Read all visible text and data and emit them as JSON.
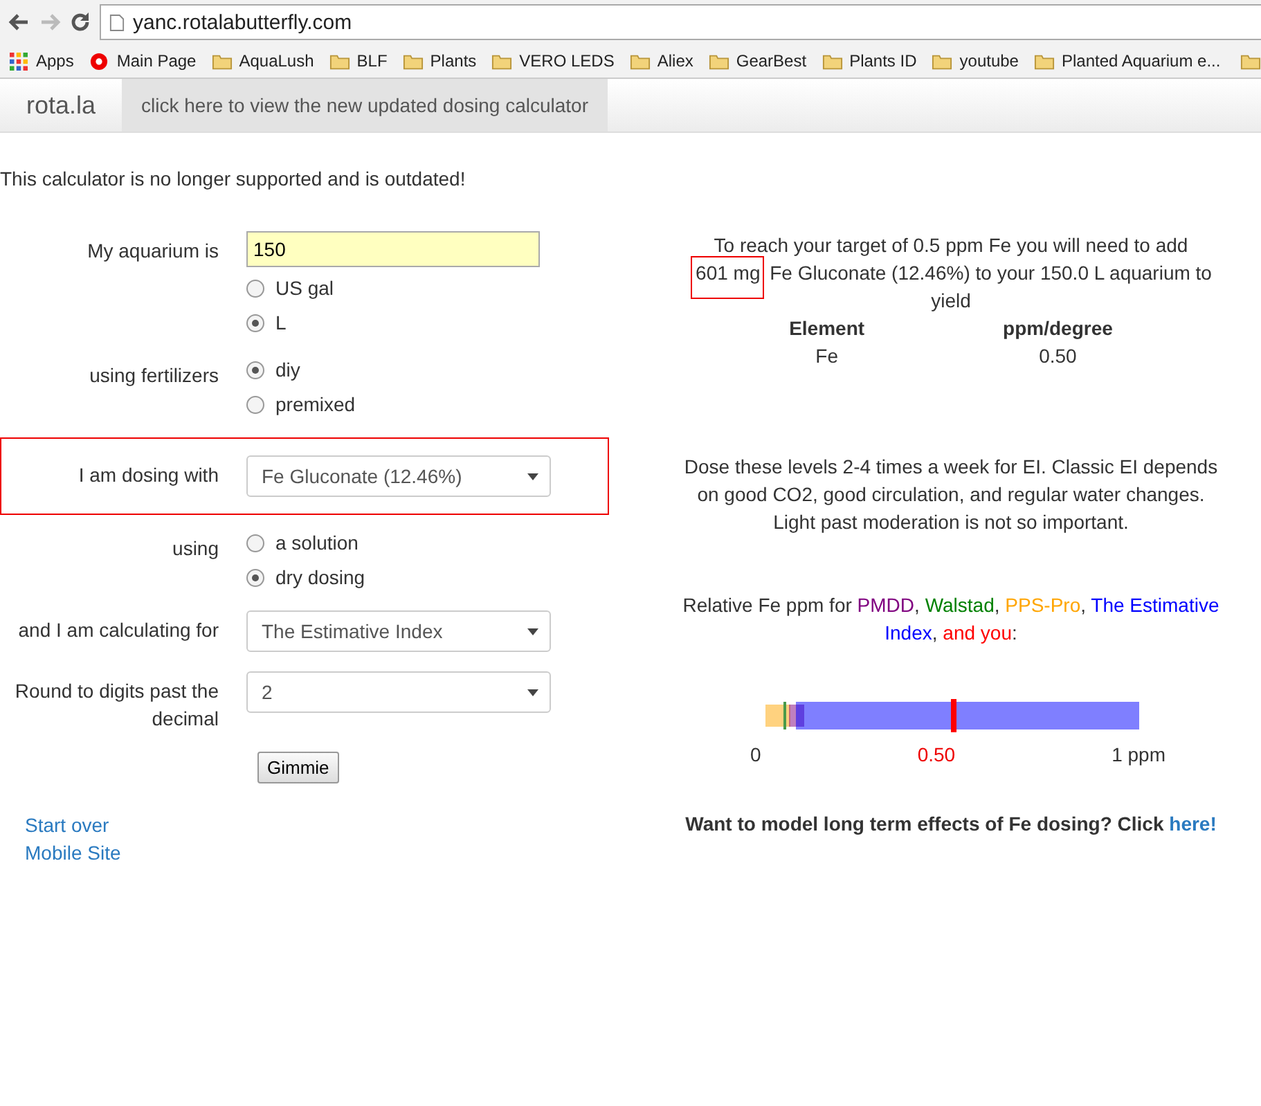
{
  "browser": {
    "url": "yanc.rotalabutterfly.com",
    "bookmarks": [
      {
        "label": "Apps",
        "kind": "apps"
      },
      {
        "label": "Main Page",
        "kind": "site"
      },
      {
        "label": "AquaLush",
        "kind": "folder"
      },
      {
        "label": "BLF",
        "kind": "folder"
      },
      {
        "label": "Plants",
        "kind": "folder"
      },
      {
        "label": "VERO LEDS",
        "kind": "folder"
      },
      {
        "label": "Aliex",
        "kind": "folder"
      },
      {
        "label": "GearBest",
        "kind": "folder"
      },
      {
        "label": "Plants ID",
        "kind": "folder"
      },
      {
        "label": "youtube",
        "kind": "folder"
      },
      {
        "label": "Planted Aquarium e...",
        "kind": "folder"
      }
    ],
    "bookmarks_cut_off": true
  },
  "navbar": {
    "brand": "rota.la",
    "link": "click here to view the new updated dosing calculator"
  },
  "notice": "This calculator is no longer supported and is outdated!",
  "form": [
    {
      "kind": "input",
      "label": "My aquarium is",
      "value": "150",
      "options": [
        {
          "label": "US gal",
          "selected": false
        },
        {
          "label": "L",
          "selected": true
        }
      ]
    },
    {
      "kind": "radio",
      "label": "using fertilizers",
      "options": [
        {
          "label": "diy",
          "selected": true
        },
        {
          "label": "premixed",
          "selected": false
        }
      ]
    },
    {
      "kind": "select",
      "label": "I am dosing with",
      "value": "Fe Gluconate (12.46%)",
      "highlighted": true
    },
    {
      "kind": "radio",
      "label": "using",
      "options": [
        {
          "label": "a solution",
          "selected": false
        },
        {
          "label": "dry dosing",
          "selected": true
        }
      ]
    },
    {
      "kind": "select",
      "label": "and I am calculating for",
      "value": "The Estimative Index",
      "highlighted": false
    },
    {
      "kind": "select",
      "label": "Round to digits past the decimal",
      "value": "2",
      "highlighted": false
    }
  ],
  "submit": "Gimmie",
  "links": [
    "Start over",
    "Mobile Site"
  ],
  "result": {
    "before": "To reach your target of 0.5 ppm Fe you will need to add",
    "amount": "601 mg",
    "amount_highlighted": true,
    "after": "Fe Gluconate (12.46%) to your 150.0 L aquarium to yield",
    "columns": [
      "Element",
      "ppm/degree"
    ],
    "rows": [
      [
        "Fe",
        "0.50"
      ]
    ]
  },
  "advice": "Dose these levels 2-4 times a week for EI. Classic EI depends on good CO2, good circulation, and regular water changes. Light past moderation is not so important.",
  "legend": [
    {
      "text": "Relative Fe ppm for ",
      "color": "#333333"
    },
    {
      "text": "PMDD",
      "color": "#800080"
    },
    {
      "text": ", ",
      "color": "#333333"
    },
    {
      "text": "Walstad",
      "color": "#008000"
    },
    {
      "text": ", ",
      "color": "#333333"
    },
    {
      "text": "PPS-Pro",
      "color": "#ffa500"
    },
    {
      "text": ", ",
      "color": "#333333"
    },
    {
      "text": "The Estimative Index",
      "color": "#0000ff"
    },
    {
      "text": ", ",
      "color": "#333333"
    },
    {
      "text": "and you",
      "color": "#ff0000"
    },
    {
      "text": ":",
      "color": "#333333"
    }
  ],
  "scale": {
    "min_label": "0",
    "mid_label": "0.50",
    "max_label": "1 ppm"
  },
  "model": {
    "text": "Want to model long term effects of Fe dosing? Click",
    "link": "here!"
  }
}
